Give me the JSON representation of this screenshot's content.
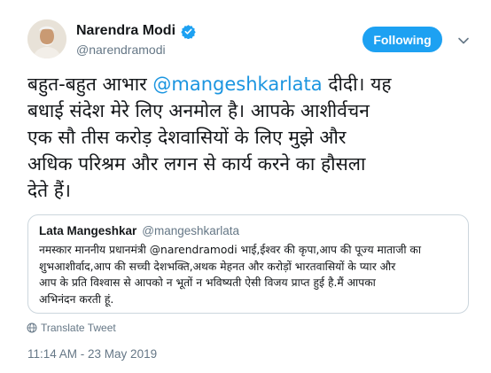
{
  "author": {
    "name": "Narendra Modi",
    "handle": "@narendramodi",
    "verified_icon": "verified-badge-icon"
  },
  "follow_button": {
    "label": "Following",
    "color": "#1da1f2"
  },
  "menu_icon": "chevron-down-icon",
  "tweet": {
    "before_mention": "बहुत-बहुत आभार ",
    "mention": "@mangeshkarlata",
    "after_mention": " दीदी। यह\nबधाई संदेश मेरे लिए अनमोल है। आपके आशीर्वचन\nएक सौ तीस करोड़ देशवासियों के लिए मुझे और\nअधिक परिश्रम और लगन से कार्य करने का हौसला\nदेते हैं।"
  },
  "quoted_tweet": {
    "name": "Lata Mangeshkar",
    "handle": "@mangeshkarlata",
    "text": "नमस्कार माननीय प्रधानमंत्री @narendramodi भाई,ईश्वर की कृपा,आप की पूज्य माताजी का\nशुभआशीर्वाद,आप की सच्ची देशभक्ति,अथक मेहनत और करोड़ों भारतवासियों के प्यार और\nआप के प्रति विश्वास से आपको न भूतों न भविष्यती ऐसी विजय प्राप्त हुई है.मैं आपका\nअभिनंदन करती हूं."
  },
  "translate_label": "Translate Tweet",
  "timestamp": "11:14 AM - 23 May 2019",
  "colors": {
    "link": "#1b95e0",
    "secondary_text": "#657786",
    "border": "#ccd6dd"
  }
}
